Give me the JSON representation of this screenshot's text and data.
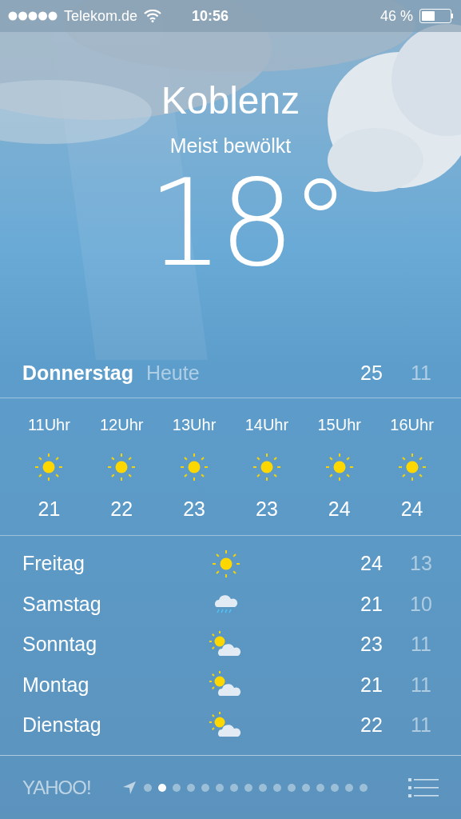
{
  "status_bar": {
    "carrier": "Telekom.de",
    "time": "10:56",
    "battery": "46 %"
  },
  "location": {
    "city": "Koblenz",
    "condition": "Meist bewölkt",
    "temperature": "18°"
  },
  "today": {
    "day": "Donnerstag",
    "label": "Heute",
    "high": "25",
    "low": "11"
  },
  "hourly": [
    {
      "time": "11Uhr",
      "kind": "sunny",
      "temp": "21"
    },
    {
      "time": "12Uhr",
      "kind": "sunny",
      "temp": "22"
    },
    {
      "time": "13Uhr",
      "kind": "sunny",
      "temp": "23"
    },
    {
      "time": "14Uhr",
      "kind": "sunny",
      "temp": "23"
    },
    {
      "time": "15Uhr",
      "kind": "sunny",
      "temp": "24"
    },
    {
      "time": "16Uhr",
      "kind": "sunny",
      "temp": "24"
    }
  ],
  "daily": [
    {
      "day": "Freitag",
      "kind": "sunny",
      "high": "24",
      "low": "13"
    },
    {
      "day": "Samstag",
      "kind": "rain",
      "high": "21",
      "low": "10"
    },
    {
      "day": "Sonntag",
      "kind": "partly-cloudy",
      "high": "23",
      "low": "11"
    },
    {
      "day": "Montag",
      "kind": "partly-cloudy",
      "high": "21",
      "low": "11"
    },
    {
      "day": "Dienstag",
      "kind": "partly-cloudy",
      "high": "22",
      "low": "11"
    }
  ],
  "footer": {
    "logo": "YAHOO!",
    "pages": [
      {
        "selected": false
      },
      {
        "selected": true
      },
      {
        "selected": false
      },
      {
        "selected": false
      },
      {
        "selected": false
      },
      {
        "selected": false
      },
      {
        "selected": false
      },
      {
        "selected": false
      },
      {
        "selected": false
      },
      {
        "selected": false
      },
      {
        "selected": false
      },
      {
        "selected": false
      },
      {
        "selected": false
      },
      {
        "selected": false
      },
      {
        "selected": false
      },
      {
        "selected": false
      }
    ]
  }
}
